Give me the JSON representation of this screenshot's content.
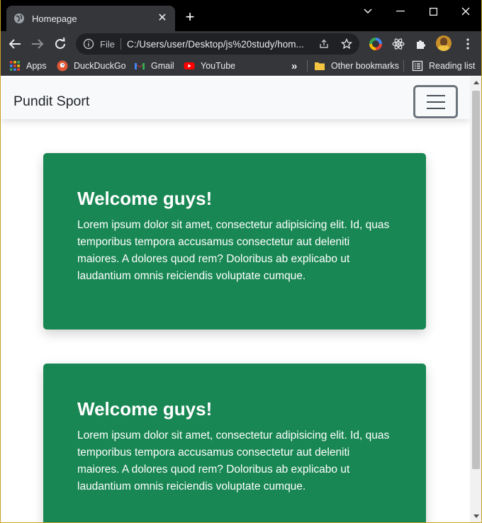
{
  "browser": {
    "tab_title": "Homepage",
    "new_tab": "+",
    "scheme_label": "File",
    "url": "C:/Users/user/Desktop/js%20study/hom..."
  },
  "bookmarks": {
    "items": [
      {
        "label": "Apps",
        "icon": "apps-grid-icon"
      },
      {
        "label": "DuckDuckGo",
        "icon": "duckduckgo-icon"
      },
      {
        "label": "Gmail",
        "icon": "gmail-icon"
      },
      {
        "label": "YouTube",
        "icon": "youtube-icon"
      }
    ],
    "overflow": "»",
    "other_bookmarks": "Other bookmarks",
    "reading_list": "Reading list"
  },
  "page": {
    "brand": "Pundit Sport",
    "cards": [
      {
        "title": "Welcome guys!",
        "body": "Lorem ipsum dolor sit amet, consectetur adipisicing elit. Id, quas temporibus tempora accusamus consectetur aut deleniti maiores. A dolores quod rem? Doloribus ab explicabo ut laudantium omnis reiciendis voluptate cumque."
      },
      {
        "title": "Welcome guys!",
        "body": "Lorem ipsum dolor sit amet, consectetur adipisicing elit. Id, quas temporibus tempora accusamus consectetur aut deleniti maiores. A dolores quod rem? Doloribus ab explicabo ut laudantium omnis reiciendis voluptate cumque."
      }
    ]
  },
  "colors": {
    "card_green": "#198754",
    "navbar_bg": "#f8f9fa",
    "chrome_dark": "#35363a"
  }
}
